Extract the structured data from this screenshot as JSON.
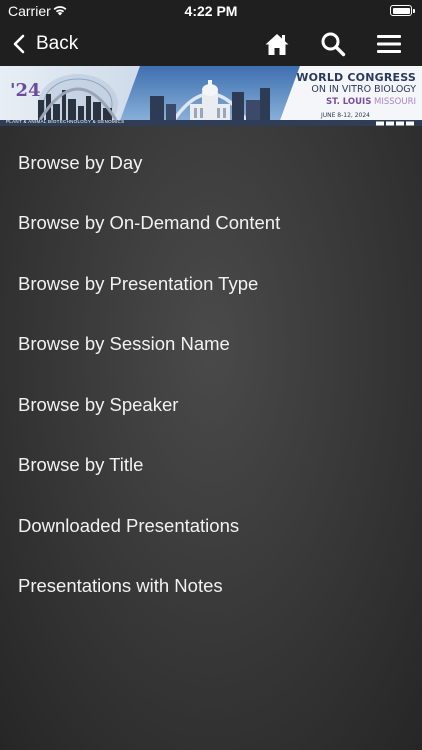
{
  "status_bar": {
    "carrier": "Carrier",
    "time": "4:22 PM"
  },
  "nav": {
    "back_label": "Back"
  },
  "banner": {
    "year": "'24",
    "title_line1": "WORLD CONGRESS",
    "title_line2": "ON IN VITRO BIOLOGY",
    "city": "ST. LOUIS",
    "state": "MISSOURI",
    "dates": "JUNE 8-12, 2024",
    "subtitle": "PLANT & ANIMAL BIOTECHNOLOGY & GENOMICS"
  },
  "menu": {
    "items": [
      {
        "label": "Browse by Day"
      },
      {
        "label": "Browse by On-Demand Content"
      },
      {
        "label": "Browse by Presentation Type"
      },
      {
        "label": "Browse by Session Name"
      },
      {
        "label": "Browse by Speaker"
      },
      {
        "label": "Browse by Title"
      },
      {
        "label": "Downloaded Presentations"
      },
      {
        "label": "Presentations with Notes"
      }
    ]
  },
  "colors": {
    "nav_bg": "#1f1f1f",
    "list_text": "#f2f2f2",
    "banner_accent": "#6c4b9c"
  }
}
